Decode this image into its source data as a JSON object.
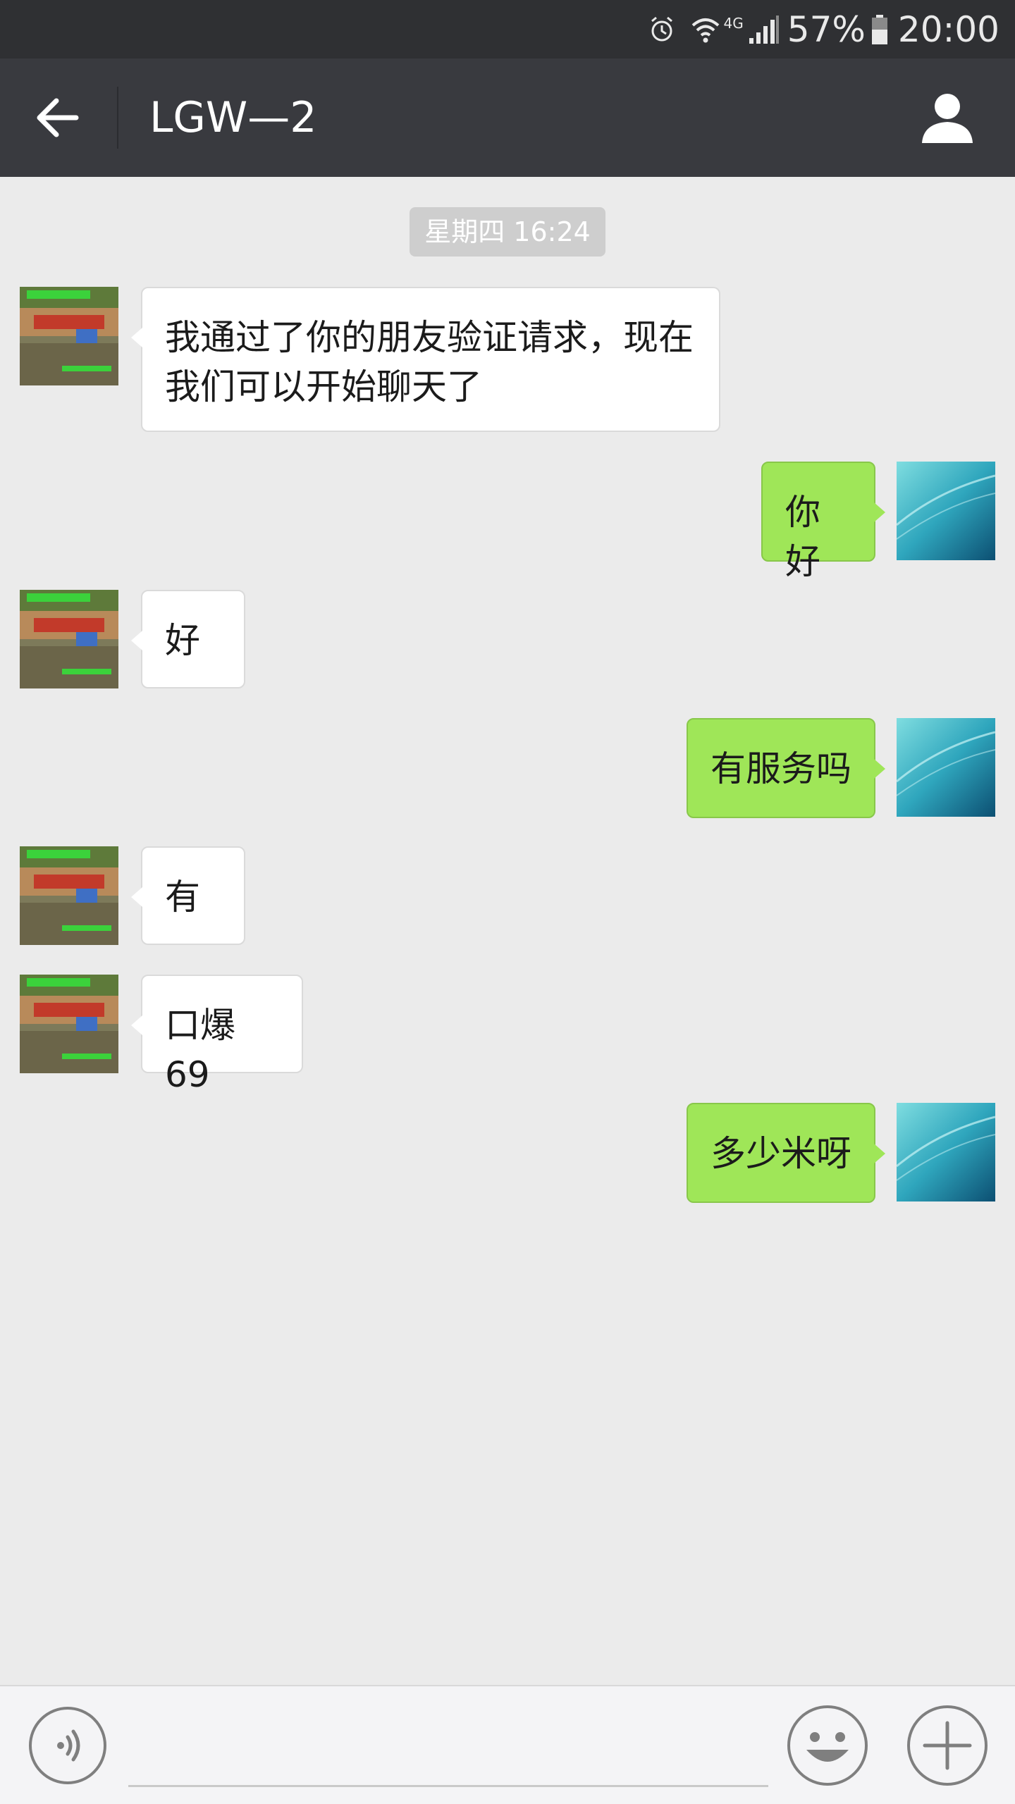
{
  "status_bar": {
    "network": "4G",
    "battery": "57%",
    "time": "20:00",
    "icons": [
      "alarm-icon",
      "wifi-icon",
      "signal-icon",
      "battery-icon"
    ]
  },
  "header": {
    "title": "LGW—2",
    "icons": [
      "back-arrow-icon",
      "profile-icon"
    ]
  },
  "chat": {
    "timestamp": "星期四 16:24",
    "messages": [
      {
        "side": "left",
        "text": "我通过了你的朋友验证请求，现在我们可以开始聊天了"
      },
      {
        "side": "right",
        "text": "你好"
      },
      {
        "side": "left",
        "text": "好"
      },
      {
        "side": "right",
        "text": "有服务吗"
      },
      {
        "side": "left",
        "text": "有"
      },
      {
        "side": "left",
        "text": "口爆69"
      },
      {
        "side": "right",
        "text": "多少米呀"
      }
    ]
  },
  "input_bar": {
    "text_value": "",
    "icons": [
      "voice-icon",
      "emoji-icon",
      "plus-icon"
    ]
  },
  "colors": {
    "status_bar_bg": "#2f3033",
    "header_bg": "#393a3f",
    "chat_bg": "#ebebeb",
    "outgoing_bubble": "#9fe658",
    "incoming_bubble": "#ffffff"
  }
}
